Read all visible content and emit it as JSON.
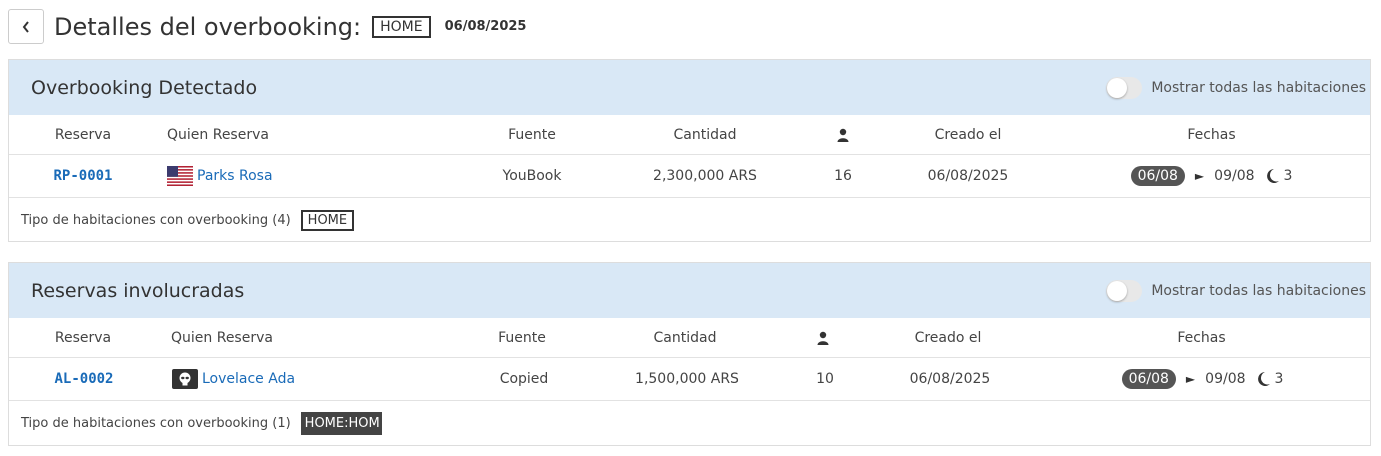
{
  "header": {
    "title": "Detalles del overbooking:",
    "room_code": "HOME",
    "date": "06/08/2025"
  },
  "icons": {
    "back": "chevron-left-icon",
    "person": "person-icon",
    "moon": "moon-icon",
    "flag": "us-flag-icon",
    "avatar": "alien-avatar-icon"
  },
  "columns": {
    "reserva": "Reserva",
    "quien": "Quien Reserva",
    "fuente": "Fuente",
    "cantidad": "Cantidad",
    "creado": "Creado el",
    "fechas": "Fechas"
  },
  "panel1": {
    "title": "Overbooking Detectado",
    "toggle_label": "Mostrar todas las habitaciones",
    "row": {
      "reserva": "RP-0001",
      "quien": "Parks Rosa",
      "fuente": "YouBook",
      "cantidad": "2,300,000 ARS",
      "personas": "16",
      "creado": "06/08/2025",
      "fecha_inicio": "06/08",
      "fecha_fin": "09/08",
      "noches": "3"
    },
    "footer_label": "Tipo de habitaciones con overbooking (4)",
    "footer_tag": "HOME"
  },
  "panel2": {
    "title": "Reservas involucradas",
    "toggle_label": "Mostrar todas las habitaciones",
    "row": {
      "reserva": "AL-0002",
      "quien": "Lovelace Ada",
      "fuente": "Copied",
      "cantidad": "1,500,000 ARS",
      "personas": "10",
      "creado": "06/08/2025",
      "fecha_inicio": "06/08",
      "fecha_fin": "09/08",
      "noches": "3"
    },
    "footer_label": "Tipo de habitaciones con overbooking (1)",
    "footer_tag": "HOME:HOME"
  },
  "colors": {
    "panel_header": "#d9e8f6",
    "link": "#1a6bb8",
    "pill": "#555555"
  }
}
